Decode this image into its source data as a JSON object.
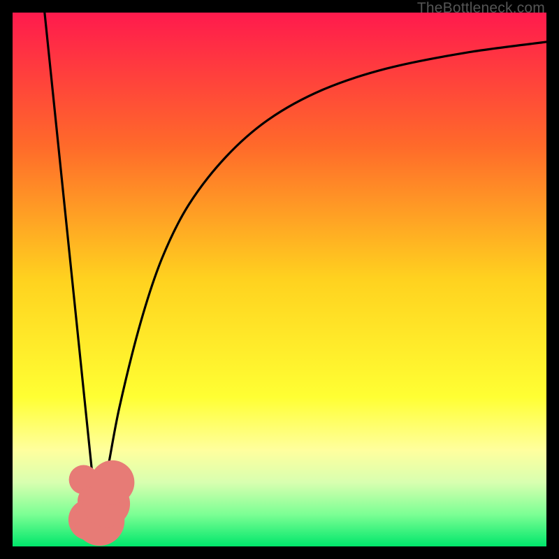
{
  "watermark": "TheBottleneck.com",
  "chart_data": {
    "type": "line",
    "title": "",
    "xlabel": "",
    "ylabel": "",
    "xlim": [
      0,
      100
    ],
    "ylim": [
      0,
      100
    ],
    "gradient_stops": [
      {
        "offset": 0,
        "color": "#ff1a4d"
      },
      {
        "offset": 25,
        "color": "#ff6a2a"
      },
      {
        "offset": 50,
        "color": "#ffd21f"
      },
      {
        "offset": 72,
        "color": "#ffff33"
      },
      {
        "offset": 82,
        "color": "#ffff9e"
      },
      {
        "offset": 88,
        "color": "#d8ffb0"
      },
      {
        "offset": 94,
        "color": "#7cff94"
      },
      {
        "offset": 100,
        "color": "#00e66b"
      }
    ],
    "series": [
      {
        "name": "left-line",
        "x": [
          6,
          15.6
        ],
        "y": [
          100,
          7
        ]
      },
      {
        "name": "right-curve",
        "x": [
          15.6,
          17.5,
          20,
          24,
          28,
          33,
          40,
          48,
          58,
          70,
          85,
          100
        ],
        "y": [
          7,
          13,
          26,
          42,
          54,
          64,
          73,
          80,
          85.5,
          89.5,
          92.5,
          94.5
        ]
      }
    ],
    "markers": [
      {
        "x": 13.3,
        "y": 12.5,
        "r": 5.0
      },
      {
        "x": 15.2,
        "y": 8.5,
        "r": 5.5
      },
      {
        "x": 14.3,
        "y": 5.0,
        "r": 7.0
      },
      {
        "x": 16.3,
        "y": 4.8,
        "r": 8.5
      },
      {
        "x": 17.6,
        "y": 8.0,
        "r": 8.0
      },
      {
        "x": 18.7,
        "y": 12.0,
        "r": 7.5
      }
    ],
    "marker_color": "#e77b76"
  }
}
